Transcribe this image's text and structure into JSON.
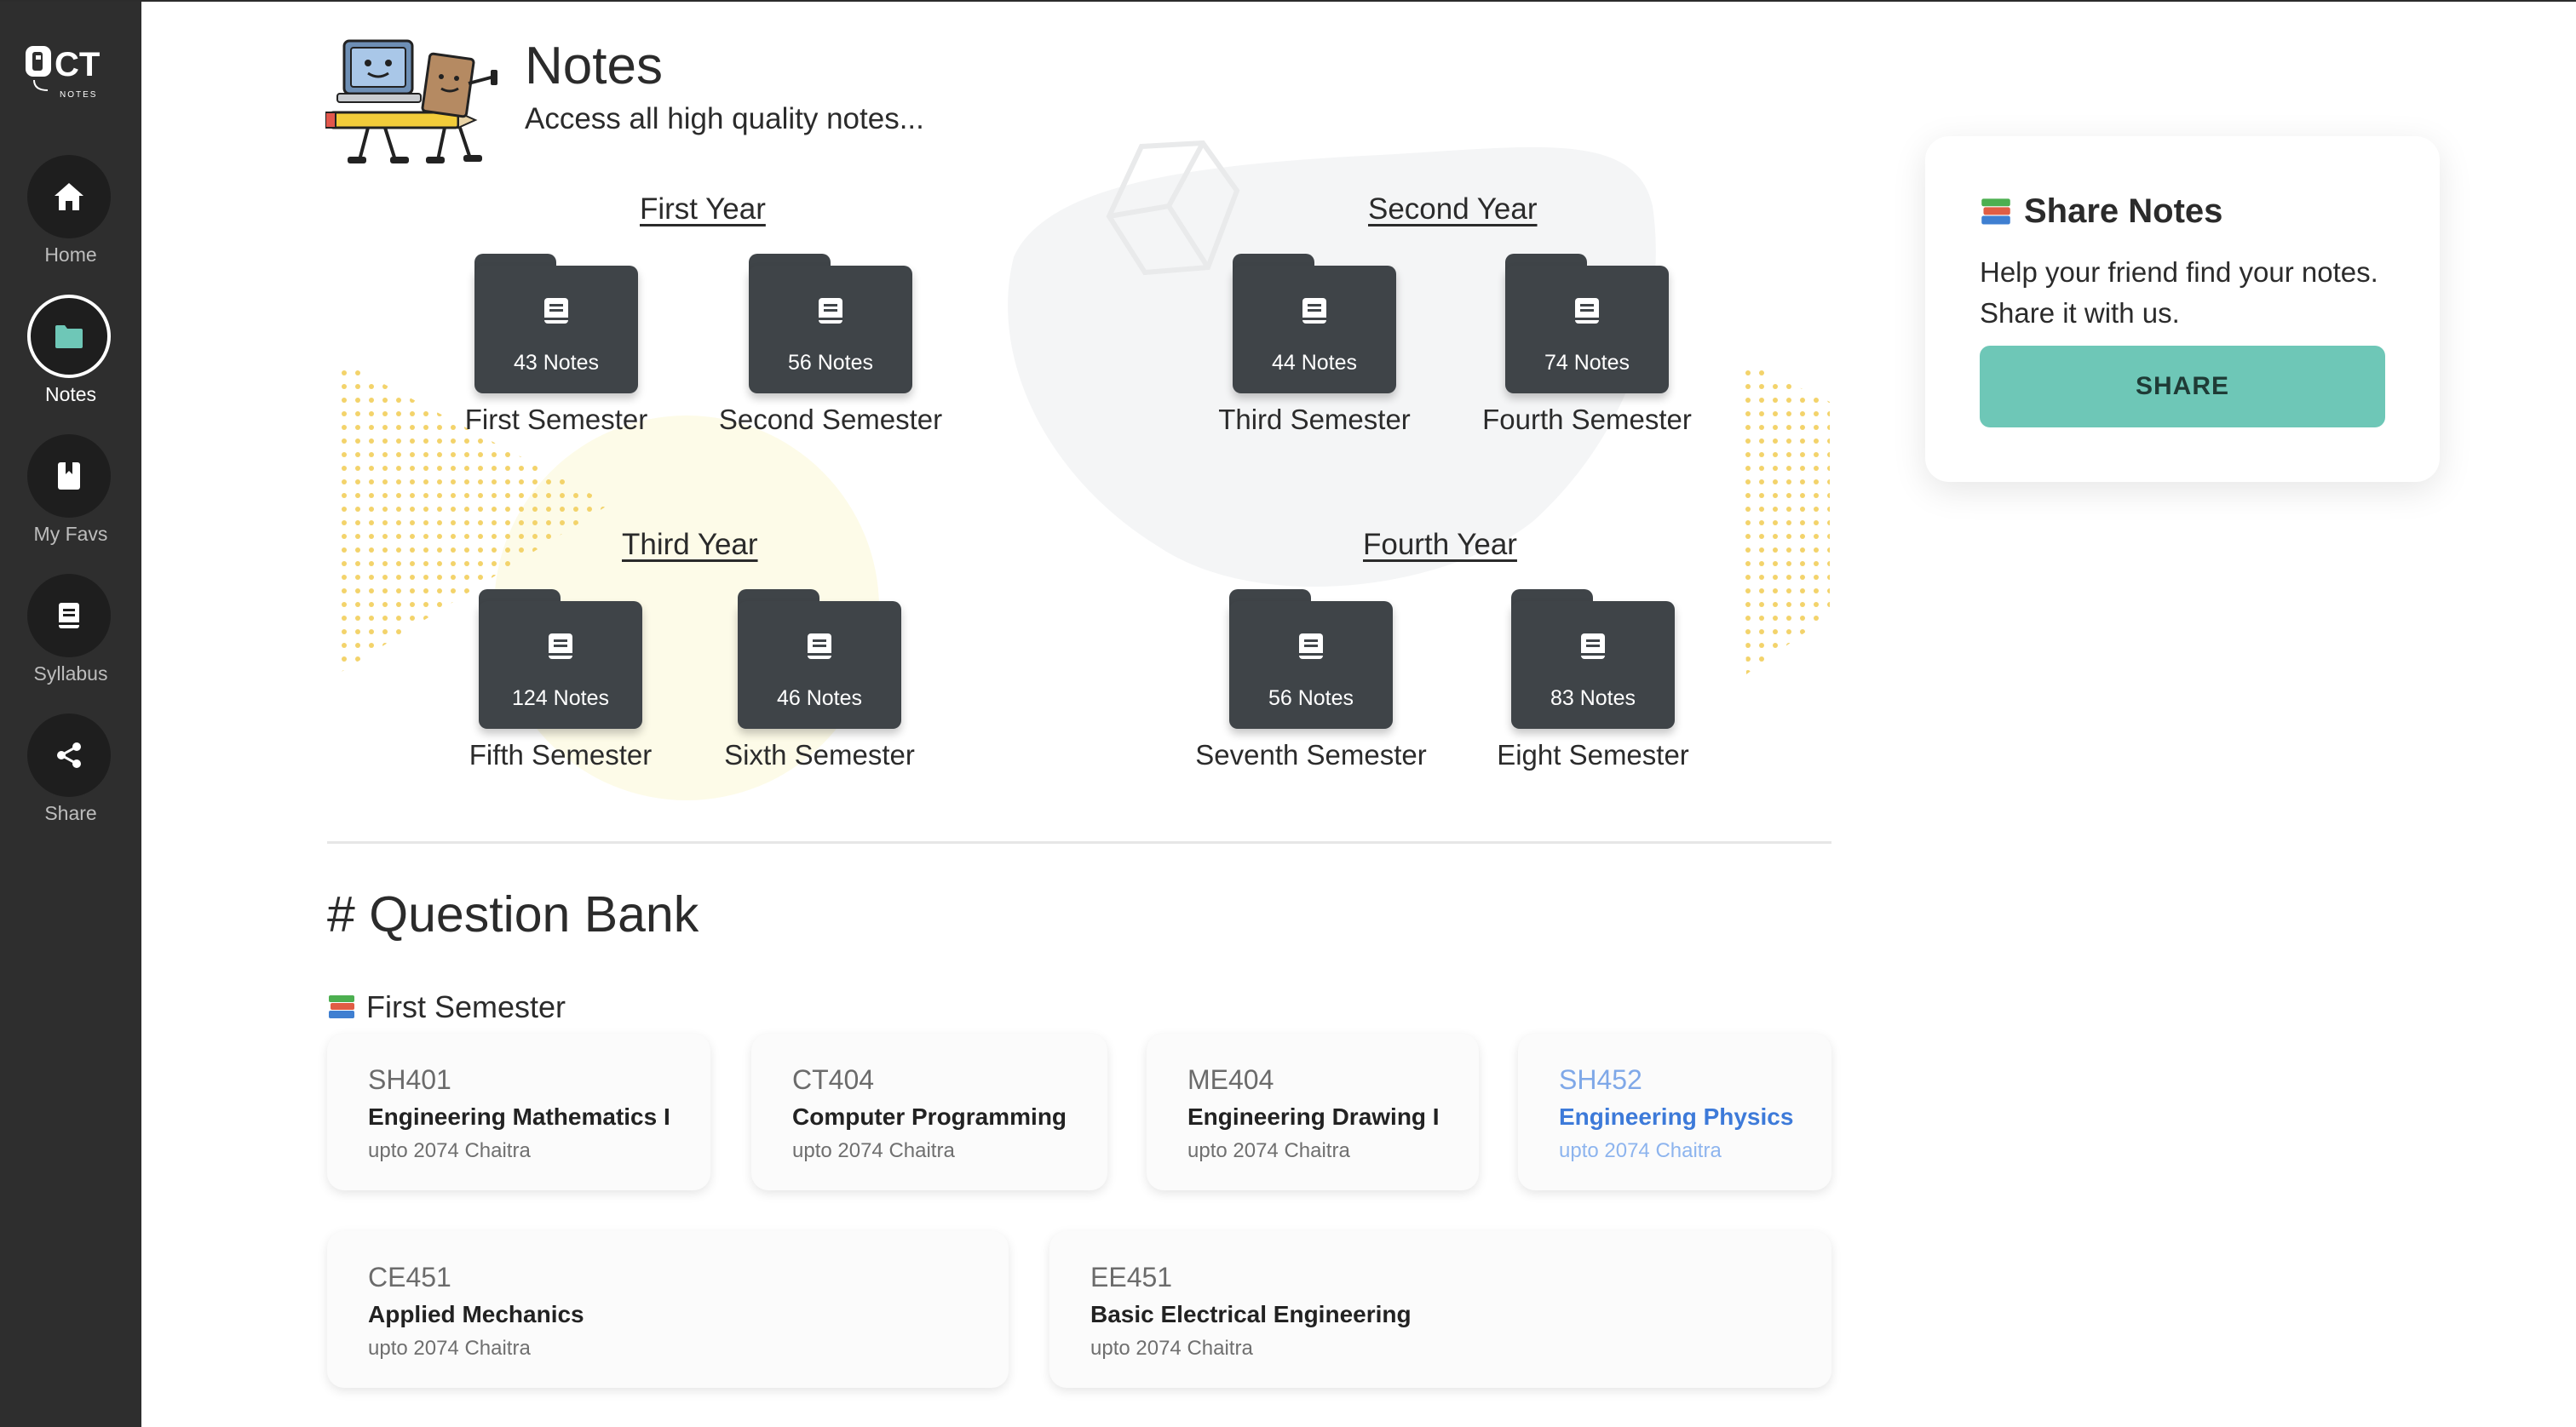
{
  "app": {
    "logo_text": "CT",
    "logo_subtext": "NOTES"
  },
  "sidebar": {
    "items": [
      {
        "label": "Home",
        "icon": "home-icon",
        "active": false
      },
      {
        "label": "Notes",
        "icon": "folder-icon",
        "active": true
      },
      {
        "label": "My Favs",
        "icon": "bookmark-icon",
        "active": false
      },
      {
        "label": "Syllabus",
        "icon": "book-icon",
        "active": false
      },
      {
        "label": "Share",
        "icon": "share-icon",
        "active": false
      }
    ]
  },
  "header": {
    "title": "Notes",
    "subtitle": "Access all high quality notes..."
  },
  "years": [
    {
      "title": "First Year",
      "semesters": [
        {
          "name": "First Semester",
          "count": "43 Notes"
        },
        {
          "name": "Second Semester",
          "count": "56 Notes"
        }
      ]
    },
    {
      "title": "Second Year",
      "semesters": [
        {
          "name": "Third Semester",
          "count": "44 Notes"
        },
        {
          "name": "Fourth Semester",
          "count": "74 Notes"
        }
      ]
    },
    {
      "title": "Third Year",
      "semesters": [
        {
          "name": "Fifth Semester",
          "count": "124 Notes"
        },
        {
          "name": "Sixth Semester",
          "count": "46 Notes"
        }
      ]
    },
    {
      "title": "Fourth Year",
      "semesters": [
        {
          "name": "Seventh Semester",
          "count": "56 Notes"
        },
        {
          "name": "Eight Semester",
          "count": "83 Notes"
        }
      ]
    }
  ],
  "question_bank": {
    "title": "# Question Bank",
    "semester_title": "First Semester",
    "cards": [
      {
        "code": "SH401",
        "name": "Engineering Mathematics I",
        "upto": "upto 2074 Chaitra",
        "highlighted": false
      },
      {
        "code": "CT404",
        "name": "Computer Programming",
        "upto": "upto 2074 Chaitra",
        "highlighted": false
      },
      {
        "code": "ME404",
        "name": "Engineering Drawing I",
        "upto": "upto 2074 Chaitra",
        "highlighted": false
      },
      {
        "code": "SH452",
        "name": "Engineering Physics",
        "upto": "upto 2074 Chaitra",
        "highlighted": true
      },
      {
        "code": "CE451",
        "name": "Applied Mechanics",
        "upto": "upto 2074 Chaitra",
        "highlighted": false
      },
      {
        "code": "EE451",
        "name": "Basic Electrical Engineering",
        "upto": "upto 2074 Chaitra",
        "highlighted": false
      }
    ]
  },
  "share_panel": {
    "title": "Share Notes",
    "description": "Help your friend find your notes. Share it with us.",
    "button_label": "SHARE"
  },
  "colors": {
    "sidebar": "#2e2e2e",
    "folder": "#3f4448",
    "accent_teal": "#6ec7b7",
    "link_blue": "#3d7ad9",
    "dot_yellow": "#f3d36b"
  }
}
